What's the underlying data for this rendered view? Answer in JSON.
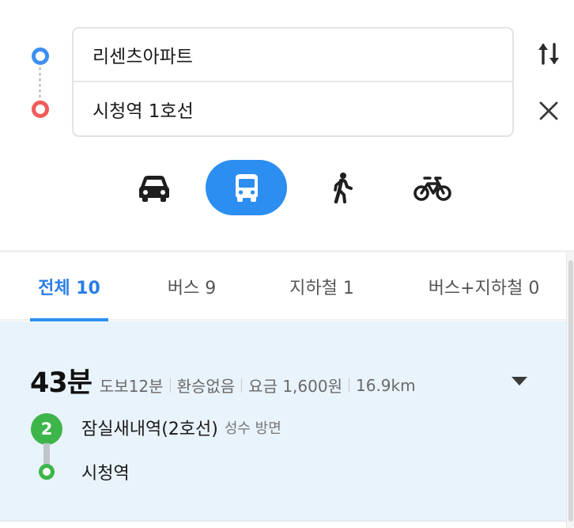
{
  "search": {
    "origin_value": "리센츠아파트",
    "destination_value": "시청역 1호선",
    "swap_icon": "swap-vertical-icon",
    "close_icon": "close-icon",
    "origin_color": "#3d8ff2",
    "destination_color": "#f25b5b"
  },
  "modes": {
    "items": [
      {
        "name": "car",
        "icon": "car-icon",
        "selected": false
      },
      {
        "name": "bus",
        "icon": "bus-icon",
        "selected": true
      },
      {
        "name": "walk",
        "icon": "walk-icon",
        "selected": false
      },
      {
        "name": "bike",
        "icon": "bike-icon",
        "selected": false
      }
    ],
    "accent_color": "#2b8ef0"
  },
  "tabs": [
    {
      "label": "전체 10",
      "active": true
    },
    {
      "label": "버스 9",
      "active": false
    },
    {
      "label": "지하철 1",
      "active": false
    },
    {
      "label": "버스+지하철 0",
      "active": false
    }
  ],
  "result": {
    "total_time": "43분",
    "walk_time": "도보12분",
    "transfer": "환승없음",
    "fare": "요금 1,600원",
    "distance": "16.9km",
    "expand_icon": "caret-down-icon",
    "line_badge": "2",
    "line_color": "#3db54a",
    "start_station": "잠실새내역(2호선)",
    "direction": "성수 방면",
    "end_station": "시청역"
  }
}
